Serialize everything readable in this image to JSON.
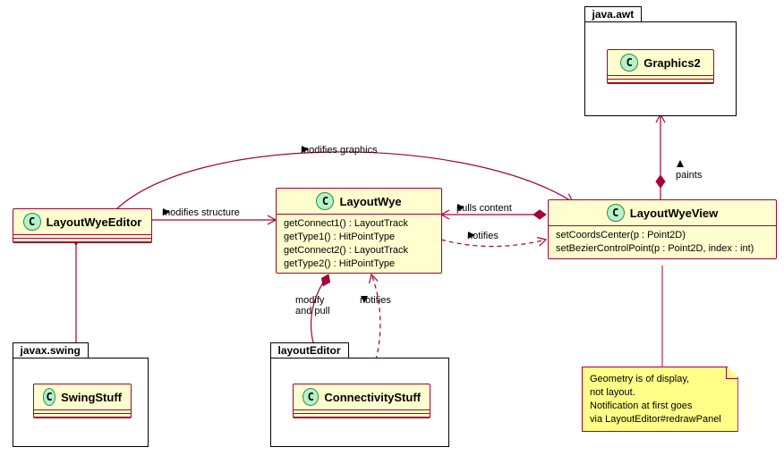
{
  "packages": {
    "awt": "java.awt",
    "swing": "javax.swing",
    "layoutEditor": "layoutEditor"
  },
  "classes": {
    "graphics2": "Graphics2",
    "layoutWyeEditor": "LayoutWyeEditor",
    "layoutWye": "LayoutWye",
    "layoutWyeView": "LayoutWyeView",
    "swingStuff": "SwingStuff",
    "connectivityStuff": "ConnectivityStuff"
  },
  "members": {
    "layoutWye": {
      "m1": "getConnect1() : LayoutTrack",
      "m2": "getType1() : HitPointType",
      "m3": "getConnect2() : LayoutTrack",
      "m4": "getType2() : HitPointType"
    },
    "layoutWyeView": {
      "m1": "setCoordsCenter(p : Point2D)",
      "m2": "setBezierControlPoint(p : Point2D, index : int)"
    }
  },
  "labels": {
    "modifiesGraphics": "modifies graphics",
    "modifiesStructure": "modifies structure",
    "pullsContent": "pulls content",
    "notifies1": "notifies",
    "modifyPull": "modify\nand pull",
    "notifies2": "notifies",
    "paints": "paints"
  },
  "note": {
    "l1": "Geometry is of display,",
    "l2": "not layout.",
    "l3": "Notification at first goes",
    "l4": "via LayoutEditor#redrawPanel"
  },
  "colors": {
    "line": "#a80036"
  }
}
